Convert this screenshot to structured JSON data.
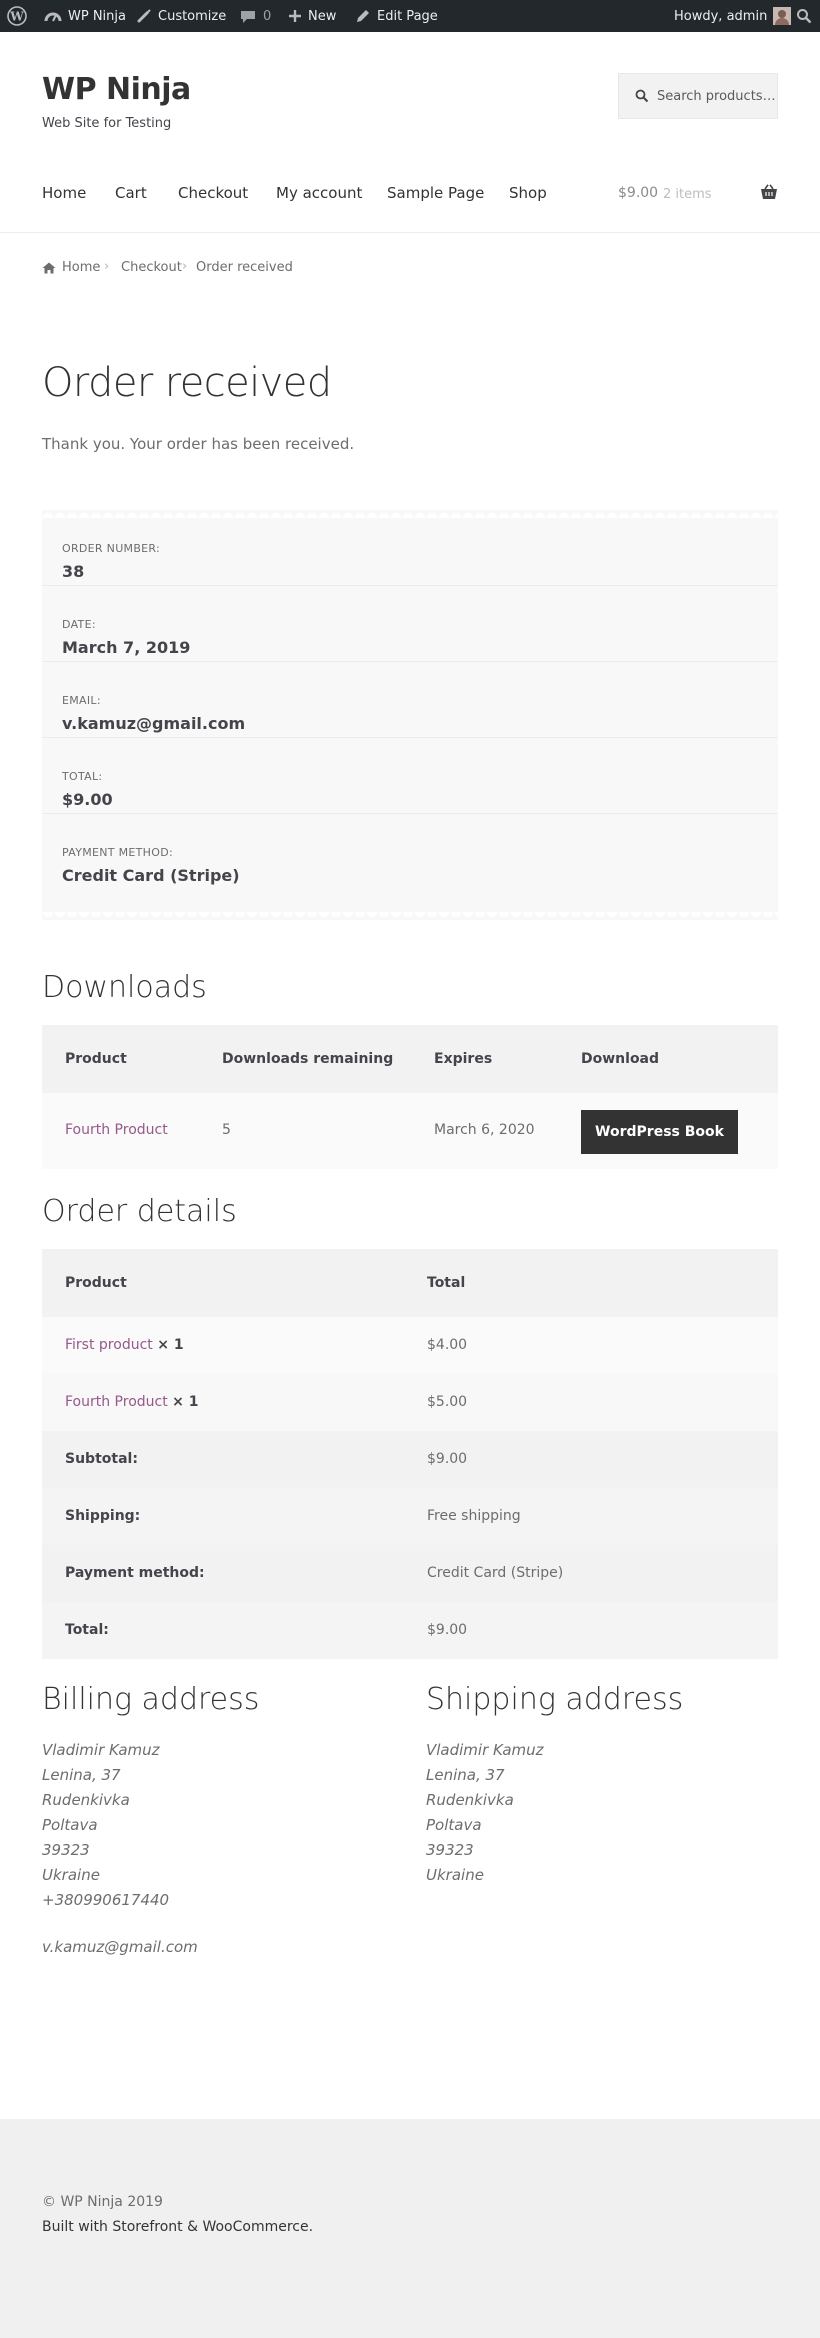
{
  "admin_bar": {
    "site_name": "WP Ninja",
    "customize": "Customize",
    "comments_count": "0",
    "new_label": "New",
    "edit_page": "Edit Page",
    "greeting": "Howdy, admin"
  },
  "header": {
    "site_title": "WP Ninja",
    "tagline": "Web Site for Testing",
    "search_placeholder": "Search products…",
    "nav": [
      "Home",
      "Cart",
      "Checkout",
      "My account",
      "Sample Page",
      "Shop"
    ],
    "cart_total": "$9.00",
    "cart_count": "2 items"
  },
  "breadcrumb": [
    "Home",
    "Checkout",
    "Order received"
  ],
  "page": {
    "title": "Order received",
    "thank_you": "Thank you. Your order has been received."
  },
  "overview": [
    {
      "label": "Order number:",
      "value": "38"
    },
    {
      "label": "Date:",
      "value": "March 7, 2019"
    },
    {
      "label": "Email:",
      "value": "v.kamuz@gmail.com"
    },
    {
      "label": "Total:",
      "value": "$9.00"
    },
    {
      "label": "Payment method:",
      "value": "Credit Card (Stripe)"
    }
  ],
  "downloads": {
    "heading": "Downloads",
    "columns": [
      "Product",
      "Downloads remaining",
      "Expires",
      "Download"
    ],
    "row": {
      "product": "Fourth Product",
      "remaining": "5",
      "expires": "March 6, 2020",
      "button": "WordPress Book"
    }
  },
  "order_details": {
    "heading": "Order details",
    "columns": [
      "Product",
      "Total"
    ],
    "items": [
      {
        "name": "First product",
        "qty": "× 1",
        "total": "$4.00"
      },
      {
        "name": "Fourth Product",
        "qty": "× 1",
        "total": "$5.00"
      }
    ],
    "summary": [
      {
        "label": "Subtotal:",
        "value": "$9.00"
      },
      {
        "label": "Shipping:",
        "value": "Free shipping"
      },
      {
        "label": "Payment method:",
        "value": "Credit Card (Stripe)"
      },
      {
        "label": "Total:",
        "value": "$9.00"
      }
    ]
  },
  "billing": {
    "heading": "Billing address",
    "lines": [
      "Vladimir Kamuz",
      "Lenina, 37",
      "Rudenkivka",
      "Poltava",
      "39323",
      "Ukraine",
      "+380990617440"
    ],
    "email": "v.kamuz@gmail.com"
  },
  "shipping": {
    "heading": "Shipping address",
    "lines": [
      "Vladimir Kamuz",
      "Lenina, 37",
      "Rudenkivka",
      "Poltava",
      "39323",
      "Ukraine"
    ]
  },
  "footer": {
    "copyright": "© WP Ninja 2019",
    "built_with": "Built with Storefront & WooCommerce."
  },
  "colors": {
    "admin_bar": "#23282d",
    "link": "#96588a",
    "button": "#333333",
    "footer_bg": "#f0f0f0"
  }
}
